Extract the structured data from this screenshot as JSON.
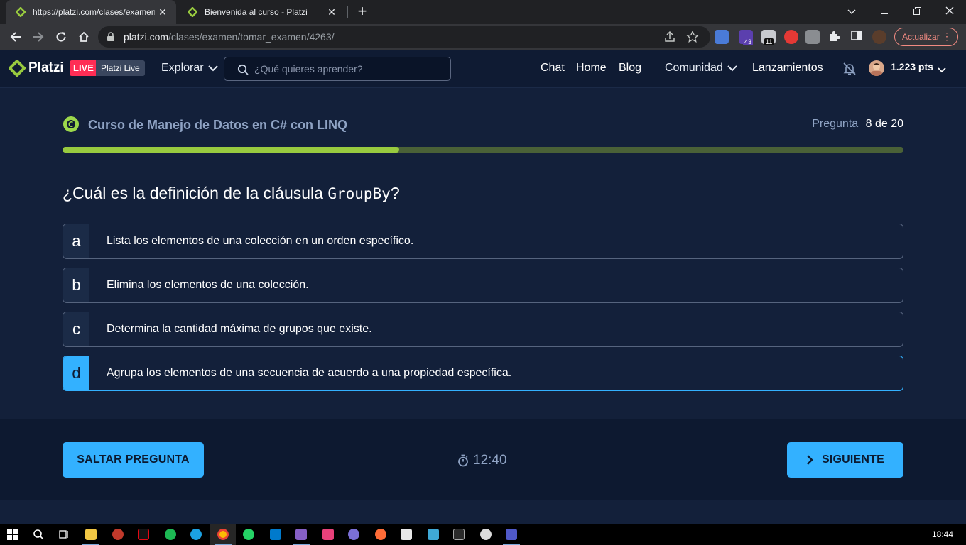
{
  "browser": {
    "tabs": [
      {
        "title": "https://platzi.com/clases/examen",
        "active": true
      },
      {
        "title": "Bienvenida al curso - Platzi",
        "active": false
      }
    ],
    "url_host": "platzi.com",
    "url_path": "/clases/examen/tomar_examen/4263/",
    "update_label": "Actualizar",
    "extension_badges": {
      "ext1": "43",
      "ext2": "11"
    }
  },
  "header": {
    "logo_text": "Platzi",
    "live_badge": "LIVE",
    "live_label": "Platzi Live",
    "explore": "Explorar",
    "search_placeholder": "¿Qué quieres aprender?",
    "nav": [
      "Chat",
      "Home",
      "Blog"
    ],
    "community": "Comunidad",
    "launches": "Lanzamientos",
    "points": "1.223 pts"
  },
  "quiz": {
    "course_title": "Curso de Manejo de Datos en C# con LINQ",
    "question_label": "Pregunta",
    "question_number": "8 de 20",
    "progress": 0.4,
    "question_prefix": "¿Cuál es la definición de la cláusula ",
    "question_code": "GroupBy",
    "question_suffix": "?",
    "options": [
      {
        "letter": "a",
        "text": "Lista los elementos de una colección en un orden específico.",
        "selected": false
      },
      {
        "letter": "b",
        "text": "Elimina los elementos de una colección.",
        "selected": false
      },
      {
        "letter": "c",
        "text": "Determina la cantidad máxima de grupos que existe.",
        "selected": false
      },
      {
        "letter": "d",
        "text": "Agrupa los elementos de una secuencia de acuerdo a una propiedad específica.",
        "selected": true
      }
    ]
  },
  "footer": {
    "skip_label": "SALTAR PREGUNTA",
    "timer": "12:40",
    "next_label": "SIGUIENTE"
  },
  "taskbar": {
    "clock": "18:44"
  },
  "colors": {
    "accent": "#33b1ff",
    "progress": "#98ca3f",
    "live": "#ff2d55",
    "background": "#13203a"
  }
}
